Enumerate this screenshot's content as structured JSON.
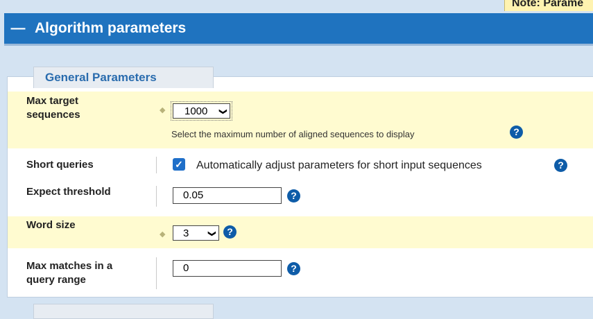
{
  "note": {
    "text": "Note: Parame"
  },
  "section": {
    "toggle": "—",
    "title": "Algorithm parameters"
  },
  "general": {
    "legend": "General Parameters"
  },
  "max_target": {
    "label_line1": "Max target",
    "label_line2": "sequences",
    "value": "1000",
    "hint": "Select the maximum number of aligned sequences to display"
  },
  "short_queries": {
    "label": "Short queries",
    "checkbox_text": "Automatically adjust parameters for short input sequences",
    "checked": true
  },
  "expect": {
    "label": "Expect threshold",
    "value": "0.05"
  },
  "word_size": {
    "label": "Word size",
    "value": "3"
  },
  "max_matches": {
    "label_line1": "Max matches in a",
    "label_line2": "query range",
    "value": "0"
  },
  "icons": {
    "help": "?",
    "chevron": "❯",
    "check": "✓",
    "diamond": "◆"
  },
  "colors": {
    "header_blue": "#1f73bf",
    "highlight": "#fffbd0",
    "legend_text": "#2a6cae"
  }
}
